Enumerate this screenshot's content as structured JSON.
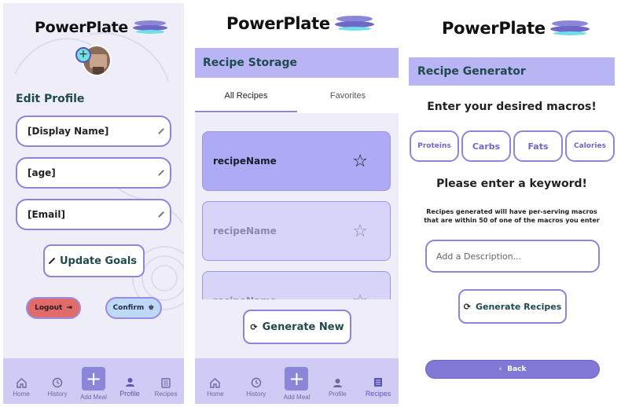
{
  "app": {
    "brand": "PowerPlate"
  },
  "profile": {
    "section_title": "Edit Profile",
    "avatar_add": "+",
    "fields": {
      "display_name": "[Display Name]",
      "age": "[age]",
      "email": "[Email]"
    },
    "update_goals_label": "Update Goals",
    "logout_label": "Logout",
    "confirm_label": "Confirm"
  },
  "storage": {
    "header": "Recipe Storage",
    "tabs": {
      "all": "All Recipes",
      "favorites": "Favorites"
    },
    "recipes": [
      {
        "name": "recipeName",
        "star": "☆"
      },
      {
        "name": "recipeName",
        "star": "☆"
      },
      {
        "name": "recipeName",
        "star": "☆"
      }
    ],
    "generate_new_label": "Generate New"
  },
  "generator": {
    "header": "Recipe Generator",
    "macros_title": "Enter your desired macros!",
    "macros": {
      "proteins": "Proteins",
      "carbs": "Carbs",
      "fats": "Fats",
      "calories": "Calories"
    },
    "keyword_title": "Please enter a keyword!",
    "note": "Recipes generated will have per-serving macros that are within 50 of one of the macros you enter",
    "description_placeholder": "Add a Description...",
    "generate_label": "Generate Recipes",
    "back_label": "Back",
    "back_arrow": "‹"
  },
  "nav": {
    "home": "Home",
    "history": "History",
    "add_meal": "Add Meal",
    "add_symbol": "+",
    "profile": "Profile",
    "recipes": "Recipes"
  },
  "colors": {
    "accent": "#8c86d8",
    "header_bar": "#b9b5f5",
    "nav_bar": "#cfcbf4",
    "logout": "#e06b6b",
    "confirm": "#bcd9f5",
    "card_active": "#aeaaf6",
    "card_inactive": "#d6d4f9"
  },
  "icons": [
    "pencil-icon",
    "refresh-icon",
    "logout-icon",
    "confirm-icon",
    "home-icon",
    "history-icon",
    "profile-icon",
    "recipes-icon",
    "star-icon",
    "back-icon"
  ]
}
